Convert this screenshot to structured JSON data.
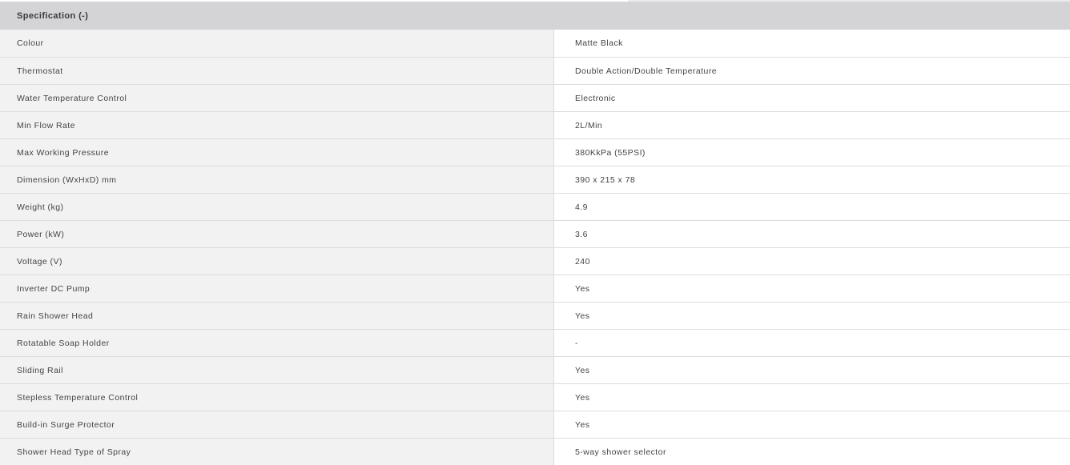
{
  "spec_table": {
    "header": "Specification (-)",
    "rows": [
      {
        "label": "Colour",
        "value": "Matte Black"
      },
      {
        "label": "Thermostat",
        "value": "Double Action/Double Temperature"
      },
      {
        "label": "Water Temperature Control",
        "value": "Electronic"
      },
      {
        "label": "Min Flow Rate",
        "value": "2L/Min"
      },
      {
        "label": "Max Working Pressure",
        "value": "380KkPa (55PSI)"
      },
      {
        "label": "Dimension (WxHxD) mm",
        "value": "390 x 215 x 78"
      },
      {
        "label": "Weight (kg)",
        "value": "4.9"
      },
      {
        "label": "Power (kW)",
        "value": "3.6"
      },
      {
        "label": "Voltage (V)",
        "value": "240"
      },
      {
        "label": "Inverter DC Pump",
        "value": "Yes"
      },
      {
        "label": "Rain Shower Head",
        "value": "Yes"
      },
      {
        "label": "Rotatable Soap Holder",
        "value": "-"
      },
      {
        "label": "Sliding Rail",
        "value": "Yes"
      },
      {
        "label": "Stepless Temperature Control",
        "value": "Yes"
      },
      {
        "label": "Build-in Surge Protector",
        "value": "Yes"
      },
      {
        "label": "Shower Head Type of Spray",
        "value": "5-way shower selector"
      }
    ]
  }
}
